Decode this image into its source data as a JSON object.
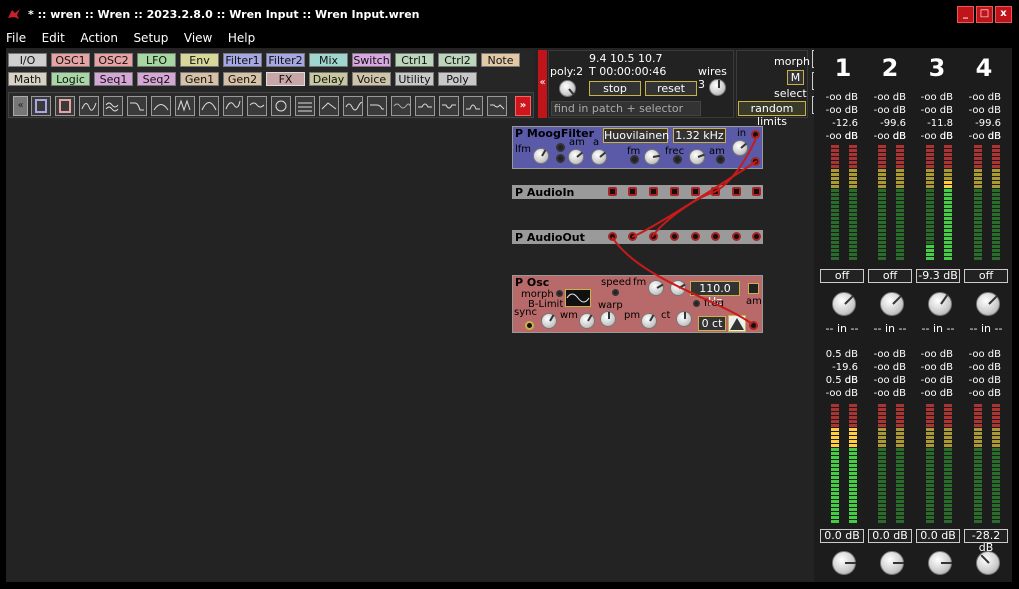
{
  "window": {
    "title": "* :: wren :: Wren :: 2023.2.8.0 :: Wren Input :: Wren Input.wren",
    "minimize": "_",
    "maximize": "□",
    "close": "x"
  },
  "menu": [
    "File",
    "Edit",
    "Action",
    "Setup",
    "View",
    "Help"
  ],
  "palette": {
    "row1": [
      {
        "label": "I/O",
        "color": "#cfcfcf"
      },
      {
        "label": "OSC1",
        "color": "#e7a3a3"
      },
      {
        "label": "OSC2",
        "color": "#e7a3a3"
      },
      {
        "label": "LFO",
        "color": "#a6d7a0"
      },
      {
        "label": "Env",
        "color": "#d7d89a"
      },
      {
        "label": "Filter1",
        "color": "#a6a8e4"
      },
      {
        "label": "Filter2",
        "color": "#a6a8e4"
      },
      {
        "label": "Mix",
        "color": "#9fd7cf"
      },
      {
        "label": "Switch",
        "color": "#d8a6e0"
      },
      {
        "label": "Ctrl1",
        "color": "#bcd6bc"
      },
      {
        "label": "Ctrl2",
        "color": "#bcd6bc"
      },
      {
        "label": "Note",
        "color": "#e3c8a6"
      }
    ],
    "row2": [
      {
        "label": "Math",
        "color": "#d8d2c4"
      },
      {
        "label": "Logic",
        "color": "#a8d7a6"
      },
      {
        "label": "Seq1",
        "color": "#d6a6d6"
      },
      {
        "label": "Seq2",
        "color": "#d6a6d6"
      },
      {
        "label": "Gen1",
        "color": "#d6c0a6"
      },
      {
        "label": "Gen2",
        "color": "#d6c0a6"
      },
      {
        "label": "FX",
        "color": "#c8a6a6"
      },
      {
        "label": "Delay",
        "color": "#c8c8a0"
      },
      {
        "label": "Voice",
        "color": "#cfc3a8"
      },
      {
        "label": "Utility",
        "color": "#c8c8c8"
      },
      {
        "label": "Poly",
        "color": "#c8c8c8"
      }
    ],
    "scroll_left": "«",
    "scroll_right": "»",
    "collapse": "«"
  },
  "control": {
    "cpu": "9.4  10.5  10.7",
    "poly": "poly:2",
    "time": "T 00:00:00:46",
    "stop_label": "stop",
    "reset_label": "reset",
    "wires": "wires 3",
    "search_placeholder": "find in patch + selector"
  },
  "morph": {
    "label": "morph",
    "m_label": "M",
    "select_label": "select",
    "random_limits_label": "random limits"
  },
  "modules": {
    "moog": {
      "title": "P MoogFilter",
      "type": "Huovilainen",
      "freq": "1.32 kHz",
      "lfm": "lfm",
      "am": "am",
      "a": "a",
      "fm": "fm",
      "frec": "frec",
      "am2": "am",
      "in": "in"
    },
    "audioin": {
      "title": "P AudioIn"
    },
    "audioout": {
      "title": "P AudioOut"
    },
    "osc": {
      "title": "P Osc",
      "morph": "morph",
      "blimit": "B-Limit",
      "speed": "speed",
      "fm": "fm",
      "freq_display": "110.0 Hz",
      "warp": "warp",
      "freq": "freq",
      "am": "am",
      "sync": "sync",
      "wm": "wm",
      "pm": "pm",
      "ct": "ct",
      "cents": "0 ct"
    }
  },
  "mixer": {
    "channels": [
      "1",
      "2",
      "3",
      "4"
    ],
    "top_levels": [
      [
        "-oo dB",
        "-oo dB",
        "-oo dB",
        "-oo dB"
      ],
      [
        "-oo dB",
        "-oo dB",
        "-oo dB",
        "-oo dB"
      ],
      [
        "-12.6 dB",
        "-99.6 dB",
        "-11.8 dB",
        "-99.6 dB"
      ],
      [
        "-oo dB",
        "-oo dB",
        "-oo dB",
        "-oo dB"
      ]
    ],
    "top_buttons": [
      "off",
      "off",
      "-9.3 dB",
      "off"
    ],
    "in_label": "-- in --",
    "bottom_levels": [
      [
        "0.5 dB",
        "-19.6 dB",
        "0.5 dB",
        "-oo dB"
      ],
      [
        "-oo dB",
        "-oo dB",
        "-oo dB",
        "-oo dB"
      ],
      [
        "-oo dB",
        "-oo dB",
        "-oo dB",
        "-oo dB"
      ],
      [
        "-oo dB",
        "-oo dB",
        "-oo dB",
        "-oo dB"
      ]
    ],
    "bottom_values": [
      "0.0 dB",
      "0.0 dB",
      "0.0 dB",
      "-28.2 dB"
    ]
  }
}
